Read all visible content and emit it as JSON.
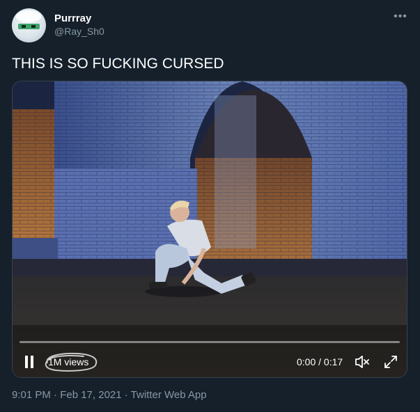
{
  "author": {
    "display_name": "Purrray",
    "handle": "@Ray_Sh0"
  },
  "tweet": {
    "text": "THIS IS SO FUCKING CURSED"
  },
  "video": {
    "views_label": "1M views",
    "time_display": "0:00 / 0:17",
    "progress_fraction": 0.0,
    "state": "playing",
    "muted": true
  },
  "meta": {
    "timestamp": "9:01 PM · Feb 17, 2021 · Twitter Web App"
  },
  "icons": {
    "more": "more-icon",
    "pause": "pause-icon",
    "mute": "volume-muted-icon",
    "fullscreen": "fullscreen-icon"
  },
  "colors": {
    "background": "#15202b",
    "secondary_text": "#8899a6",
    "accent": "#1da1f2"
  }
}
